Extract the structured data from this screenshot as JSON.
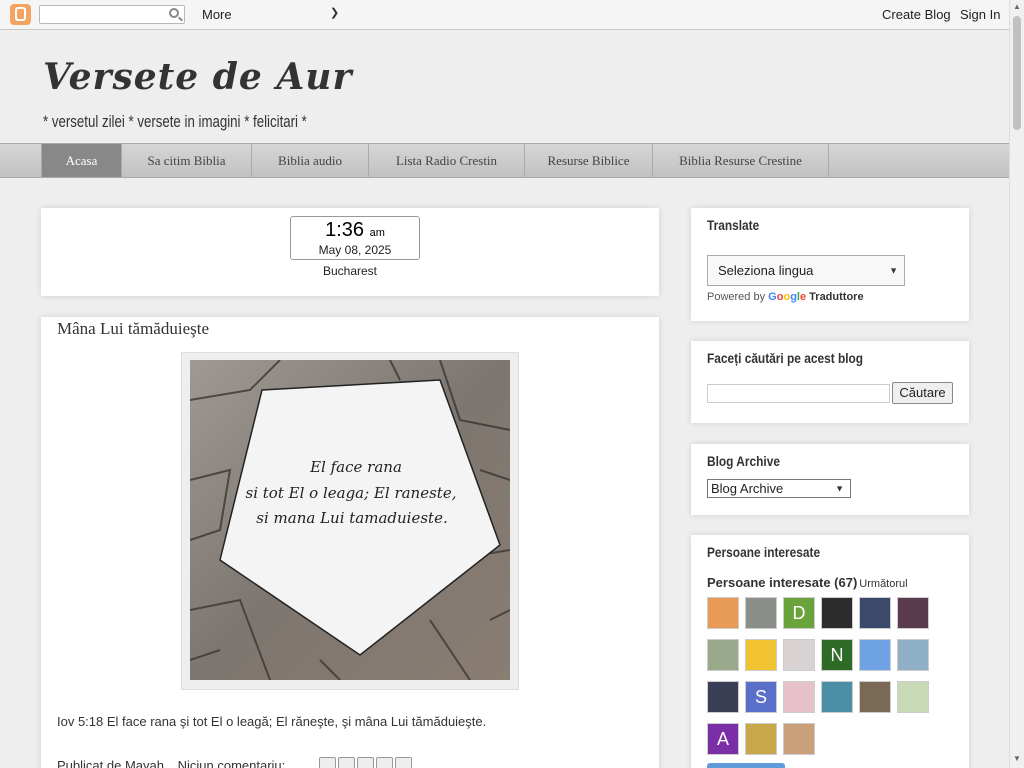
{
  "navbar": {
    "more_label": "More",
    "create_blog": "Create Blog",
    "sign_in": "Sign In"
  },
  "header": {
    "title": "Versete de Aur",
    "description": "* versetul zilei * versete in imagini * felicitari *"
  },
  "tabs": [
    {
      "label": "Acasa",
      "active": true
    },
    {
      "label": "Sa citim Biblia",
      "active": false
    },
    {
      "label": "Biblia audio",
      "active": false
    },
    {
      "label": "Lista Radio Crestin",
      "active": false
    },
    {
      "label": "Resurse Biblice",
      "active": false
    },
    {
      "label": "Biblia Resurse Crestine",
      "active": false
    }
  ],
  "clock": {
    "time": "1:36",
    "ampm": "am",
    "date": "May 08, 2025",
    "city": "Bucharest"
  },
  "post": {
    "title": "Mâna Lui tămăduieşte",
    "image_text": [
      "El face rana",
      "si tot El o leaga; El raneste,",
      "si mana Lui tamaduieste."
    ],
    "body": "Iov 5:18 El face rana şi tot El o leagă; El răneşte, şi mâna Lui tămăduieşte.",
    "footer_prefix": "Publicat de",
    "author": "Mayah",
    "comments": "Niciun comentariu:"
  },
  "sidebar": {
    "translate": {
      "title": "Translate",
      "select_value": "Seleziona lingua",
      "powered_by": "Powered by",
      "google": "Google",
      "traduttore": "Traduttore"
    },
    "search": {
      "title": "Faceți căutări pe acest blog",
      "button": "Căutare"
    },
    "archive": {
      "title": "Blog Archive",
      "select_value": "Blog Archive"
    },
    "followers": {
      "title": "Persoane interesate",
      "count_label": "Persoane interesate (67)",
      "next": "Următorul",
      "avatars": [
        {
          "letter": "",
          "color": "#e89b57"
        },
        {
          "letter": "",
          "color": "#8a8f8a"
        },
        {
          "letter": "D",
          "color": "#6aa33a"
        },
        {
          "letter": "",
          "color": "#2c2c2c"
        },
        {
          "letter": "",
          "color": "#3b4a6b"
        },
        {
          "letter": "",
          "color": "#5a3b4e"
        },
        {
          "letter": "",
          "color": "#9aa88b"
        },
        {
          "letter": "",
          "color": "#f1c232"
        },
        {
          "letter": "",
          "color": "#d9d2d2"
        },
        {
          "letter": "N",
          "color": "#2e6b26"
        },
        {
          "letter": "",
          "color": "#6fa3e6"
        },
        {
          "letter": "",
          "color": "#8fb0c7"
        },
        {
          "letter": "",
          "color": "#3a3f55"
        },
        {
          "letter": "S",
          "color": "#5a70c8"
        },
        {
          "letter": "",
          "color": "#e7c1c9"
        },
        {
          "letter": "",
          "color": "#4a8fa6"
        },
        {
          "letter": "",
          "color": "#7a6a55"
        },
        {
          "letter": "",
          "color": "#c8d9b6"
        },
        {
          "letter": "A",
          "color": "#7b2fa7"
        },
        {
          "letter": "",
          "color": "#c8a64a"
        },
        {
          "letter": "",
          "color": "#c9a07a"
        }
      ]
    }
  }
}
